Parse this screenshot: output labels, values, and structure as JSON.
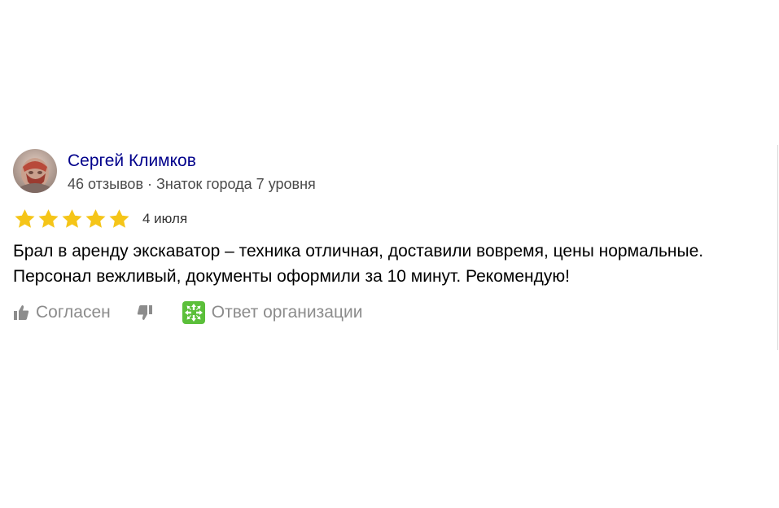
{
  "review": {
    "author": {
      "name": "Сергей Климков",
      "meta": "46 отзывов · Знаток города 7 уровня",
      "avatar_icon": "user-avatar-photo"
    },
    "rating": {
      "value": 5,
      "max": 5,
      "star_color": "#f5c518"
    },
    "date": "4 июля",
    "text": "Брал в аренду экскаватор – техника отличная, доставили вовремя, цены нормальные. Персонал вежливый, документы оформили за 10 минут. Рекомендую!",
    "actions": {
      "like_label": "Согласен",
      "like_icon": "thumbs-up-icon",
      "dislike_icon": "thumbs-down-icon",
      "org_reply_label": "Ответ организации",
      "org_reply_icon": "organization-reply-icon"
    }
  },
  "colors": {
    "author_name": "#00008b",
    "muted_text": "#8c8c8c",
    "org_icon_green": "#5bbf3a"
  }
}
